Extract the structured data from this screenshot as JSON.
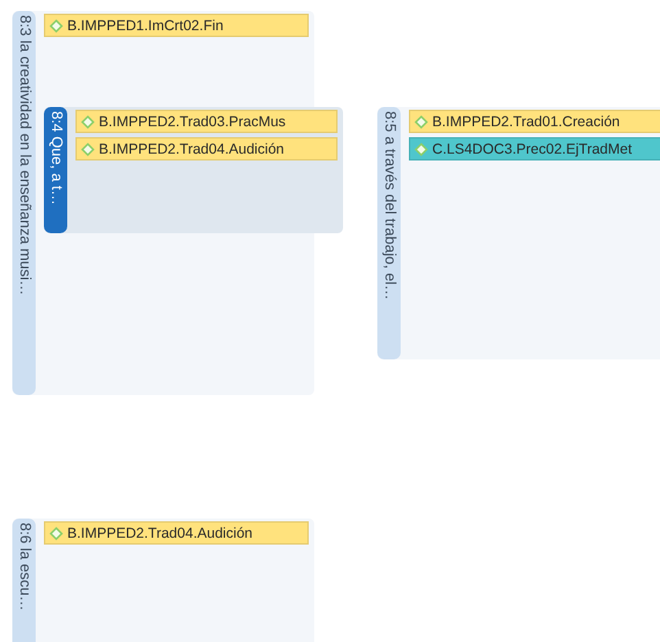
{
  "groups": [
    {
      "label": "8:3 la creatividad en la enseñanza musi…",
      "selected": false,
      "codes": [
        {
          "text": "B.IMPPED1.ImCrt02.Fin",
          "color": "#ffe27d"
        }
      ]
    },
    {
      "label": "8:4 Que, a t…",
      "selected": true,
      "codes": [
        {
          "text": "B.IMPPED2.Trad03.PracMus",
          "color": "#ffe27d"
        },
        {
          "text": "B.IMPPED2.Trad04.Audición",
          "color": "#ffe27d"
        }
      ]
    },
    {
      "label": "8:5 a través del trabajo, el…",
      "selected": false,
      "codes": [
        {
          "text": "B.IMPPED2.Trad01.Creación",
          "color": "#ffe27d"
        },
        {
          "text": "C.LS4DOC3.Prec02.EjTradMet",
          "color": "#4fc6cc"
        }
      ]
    },
    {
      "label": "8:6 la escu…",
      "selected": false,
      "codes": [
        {
          "text": "B.IMPPED2.Trad04.Audición",
          "color": "#ffe27d"
        }
      ]
    }
  ]
}
